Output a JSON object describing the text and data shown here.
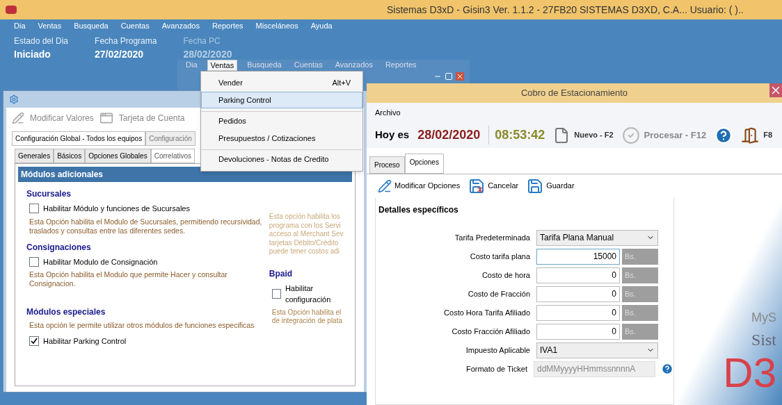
{
  "app": {
    "title": "Sistemas D3xD - Gisin3  Ver.  1.1.2 - 27FB20  SISTEMAS D3XD, C.A... Usuario: ( )..",
    "menu": [
      "Dia",
      "Ventas",
      "Busqueda",
      "Cuentas",
      "Avanzados",
      "Reportes",
      "Misceláneos",
      "Ayuda"
    ],
    "status": [
      {
        "label": "Estado del Dia",
        "value": "Iniciado",
        "faded": false
      },
      {
        "label": "Fecha Programa",
        "value": "27/02/2020",
        "faded": false
      },
      {
        "label": "Fecha PC",
        "value": "28/02/2020",
        "faded": true
      }
    ]
  },
  "ghost_window": {
    "menu": [
      {
        "label": "Dia",
        "selected": false
      },
      {
        "label": "Ventas",
        "selected": true
      },
      {
        "label": "Busqueda",
        "selected": false
      },
      {
        "label": "Cuentas",
        "selected": false
      },
      {
        "label": "Avanzados",
        "selected": false
      },
      {
        "label": "Reportes",
        "selected": false
      }
    ]
  },
  "dropdown": [
    {
      "label": "Vender",
      "shortcut": "Alt+V",
      "selected": false,
      "separator_before": false
    },
    {
      "label": "Parking Control",
      "selected": true,
      "separator_before": false
    },
    {
      "label": "Pedidos",
      "selected": false,
      "separator_before": true
    },
    {
      "label": "Presupuestos / Cotizaciones",
      "selected": false,
      "separator_before": false
    },
    {
      "label": "Devoluciones  - Notas de Credito",
      "selected": false,
      "separator_before": true
    }
  ],
  "config_window": {
    "toolbar": [
      "Modificar Valores",
      "Tarjeta de Cuenta"
    ],
    "tabs": [
      {
        "label": "Configuración Global - Todos los equipos",
        "selected": true
      },
      {
        "label": "Configuración",
        "selected": false
      }
    ],
    "subtabs": [
      {
        "label": "Generales",
        "selected": false
      },
      {
        "label": "Básicos",
        "selected": false
      },
      {
        "label": "Opciones Globales",
        "selected": false
      },
      {
        "label": "Correlativos",
        "selected": true
      }
    ],
    "header": "Módulos adicionales",
    "left_sections": [
      {
        "title": "Sucursales",
        "checkbox": {
          "label": "Habilitar Módulo y funciones de Sucursales",
          "checked": false
        },
        "description": "Esta Opción habilita el Modulo de Sucursales, permitiendo recursividad, traslados y consultas entre las diferentes sedes."
      },
      {
        "title": "Consignaciones",
        "checkbox": {
          "label": "Habilitar Modulo de Consignación",
          "checked": false
        },
        "description": "Esta Opción habilita el Modulo que permite Hacer y consultar Consignacion."
      },
      {
        "title": "Módulos especiales",
        "description": "Esta opción le permite utilizar otros módulos de funciones especificas",
        "checkbox": {
          "label": "Habilitar Parking Control",
          "checked": true
        }
      }
    ],
    "right_description": "Esta opción habilita los\nprograma con los Servi\nacceso al Merchant Sev\ntarjetas Débito/Crédito\npuede tener costos adi",
    "right_section": {
      "title": "Bpaid",
      "checkbox": {
        "label": "Habilitar configuración",
        "checked": false
      },
      "description": "Esta Opción habilita el\nde integración de plata"
    }
  },
  "cobro_window": {
    "title": "Cobro de Estacionamiento",
    "menu": [
      "Archivo"
    ],
    "today_label": "Hoy es",
    "date": "28/02/2020",
    "time": "08:53:42",
    "actions": [
      {
        "kind": "new",
        "label": "Nuevo - F2",
        "disabled": false
      },
      {
        "kind": "process",
        "label": "Procesar - F12",
        "disabled": true
      },
      {
        "kind": "help"
      },
      {
        "kind": "exit",
        "label": "F8",
        "disabled": false
      }
    ],
    "tabs": [
      {
        "label": "Proceso",
        "selected": false
      },
      {
        "label": "Opciones",
        "selected": true
      }
    ],
    "toolbar": [
      {
        "kind": "edit",
        "label": "Modificar Opciones"
      },
      {
        "kind": "cancel",
        "label": "Cancelar"
      },
      {
        "kind": "save",
        "label": "Guardar"
      }
    ],
    "section": "Detalles específicos",
    "fields": [
      {
        "kind": "select",
        "label": "Tarifa Predeterminada",
        "value": "Tarifa Plana Manual"
      },
      {
        "kind": "money",
        "label": "Costo tarifa plana",
        "value": "15000",
        "unit": "Bs.",
        "focused": true
      },
      {
        "kind": "money",
        "label": "Costo de hora",
        "value": "0",
        "unit": "Bs.",
        "focused": false
      },
      {
        "kind": "money",
        "label": "Costo de Fracción",
        "value": "0",
        "unit": "Bs.",
        "focused": false
      },
      {
        "kind": "money",
        "label": "Costo Hora Tarifa Afiliado",
        "value": "0",
        "unit": "Bs.",
        "focused": false
      },
      {
        "kind": "money",
        "label": "Costo Fracción Afiliado",
        "value": "0",
        "unit": "Bs.",
        "focused": false
      },
      {
        "kind": "select",
        "label": "Impuesto Aplicable",
        "value": "IVA1"
      },
      {
        "kind": "readonly",
        "label": "Formato de Ticket",
        "value": "ddMMyyyyHHmmssnnnnA"
      }
    ],
    "logo": [
      "MyS",
      "Sist",
      "D3"
    ]
  }
}
